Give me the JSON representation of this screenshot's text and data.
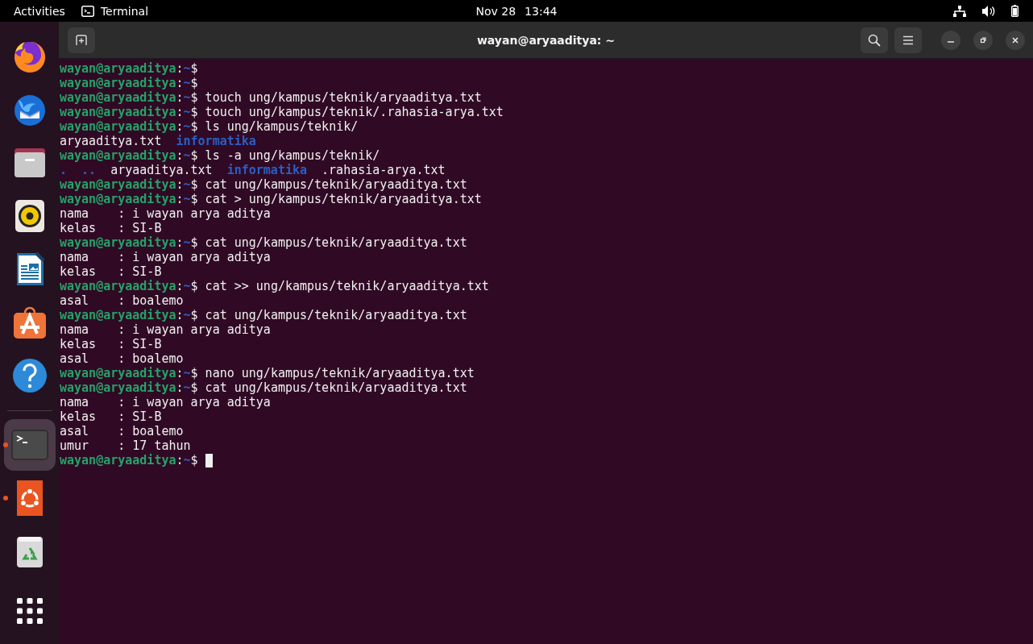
{
  "top_bar": {
    "activities": "Activities",
    "app_name": "Terminal",
    "date": "Nov 28",
    "time": "13:44"
  },
  "dock": {
    "items": [
      {
        "running": false,
        "selected": false
      },
      {
        "running": false,
        "selected": false
      },
      {
        "running": false,
        "selected": false
      },
      {
        "running": false,
        "selected": false
      },
      {
        "running": false,
        "selected": false
      },
      {
        "running": false,
        "selected": false
      },
      {
        "running": false,
        "selected": false
      },
      {
        "running": true,
        "selected": true
      },
      {
        "running": true,
        "selected": false
      },
      {
        "running": false,
        "selected": false
      },
      {
        "running": false,
        "selected": false
      }
    ]
  },
  "window": {
    "title": "wayan@aryaaditya: ~"
  },
  "terminal": {
    "lines": [
      {
        "kind": "prompt",
        "user": "wayan@aryaaditya",
        "separator": ":",
        "path": "~",
        "symbol": "$"
      },
      {
        "kind": "prompt",
        "user": "wayan@aryaaditya",
        "separator": ":",
        "path": "~",
        "symbol": "$"
      },
      {
        "kind": "prompt",
        "user": "wayan@aryaaditya",
        "separator": ":",
        "path": "~",
        "symbol": "$",
        "command": "touch ung/kampus/teknik/aryaaditya.txt"
      },
      {
        "kind": "prompt",
        "user": "wayan@aryaaditya",
        "separator": ":",
        "path": "~",
        "symbol": "$",
        "command": "touch ung/kampus/teknik/.rahasia-arya.txt"
      },
      {
        "kind": "prompt",
        "user": "wayan@aryaaditya",
        "separator": ":",
        "path": "~",
        "symbol": "$",
        "command": "ls ung/kampus/teknik/"
      },
      {
        "kind": "listing",
        "entries": [
          {
            "kind": "file",
            "text": "aryaaditya.txt"
          },
          {
            "kind": "dir",
            "text": "informatika"
          }
        ]
      },
      {
        "kind": "prompt",
        "user": "wayan@aryaaditya",
        "separator": ":",
        "path": "~",
        "symbol": "$",
        "command": "ls -a ung/kampus/teknik/"
      },
      {
        "kind": "listing",
        "entries": [
          {
            "kind": "dir",
            "text": "."
          },
          {
            "kind": "dir",
            "text": ".."
          },
          {
            "kind": "file",
            "text": "aryaaditya.txt"
          },
          {
            "kind": "dir",
            "text": "informatika"
          },
          {
            "kind": "file",
            "text": ".rahasia-arya.txt"
          }
        ]
      },
      {
        "kind": "prompt",
        "user": "wayan@aryaaditya",
        "separator": ":",
        "path": "~",
        "symbol": "$",
        "command": "cat ung/kampus/teknik/aryaaditya.txt"
      },
      {
        "kind": "prompt",
        "user": "wayan@aryaaditya",
        "separator": ":",
        "path": "~",
        "symbol": "$",
        "command": "cat > ung/kampus/teknik/aryaaditya.txt"
      },
      {
        "kind": "output",
        "text": "nama    : i wayan arya aditya"
      },
      {
        "kind": "output",
        "text": "kelas   : SI-B"
      },
      {
        "kind": "prompt",
        "user": "wayan@aryaaditya",
        "separator": ":",
        "path": "~",
        "symbol": "$",
        "command": "cat ung/kampus/teknik/aryaaditya.txt"
      },
      {
        "kind": "output",
        "text": "nama    : i wayan arya aditya"
      },
      {
        "kind": "output",
        "text": "kelas   : SI-B"
      },
      {
        "kind": "prompt",
        "user": "wayan@aryaaditya",
        "separator": ":",
        "path": "~",
        "symbol": "$",
        "command": "cat >> ung/kampus/teknik/aryaaditya.txt"
      },
      {
        "kind": "output",
        "text": "asal    : boalemo"
      },
      {
        "kind": "prompt",
        "user": "wayan@aryaaditya",
        "separator": ":",
        "path": "~",
        "symbol": "$",
        "command": "cat ung/kampus/teknik/aryaaditya.txt"
      },
      {
        "kind": "output",
        "text": "nama    : i wayan arya aditya"
      },
      {
        "kind": "output",
        "text": "kelas   : SI-B"
      },
      {
        "kind": "output",
        "text": "asal    : boalemo"
      },
      {
        "kind": "prompt",
        "user": "wayan@aryaaditya",
        "separator": ":",
        "path": "~",
        "symbol": "$",
        "command": "nano ung/kampus/teknik/aryaaditya.txt"
      },
      {
        "kind": "prompt",
        "user": "wayan@aryaaditya",
        "separator": ":",
        "path": "~",
        "symbol": "$",
        "command": "cat ung/kampus/teknik/aryaaditya.txt"
      },
      {
        "kind": "output",
        "text": "nama    : i wayan arya aditya"
      },
      {
        "kind": "output",
        "text": "kelas   : SI-B"
      },
      {
        "kind": "output",
        "text": "asal    : boalemo"
      },
      {
        "kind": "output",
        "text": "umur    : 17 tahun"
      },
      {
        "kind": "prompt",
        "user": "wayan@aryaaditya",
        "separator": ":",
        "path": "~",
        "symbol": "$",
        "cursor": true
      }
    ]
  }
}
